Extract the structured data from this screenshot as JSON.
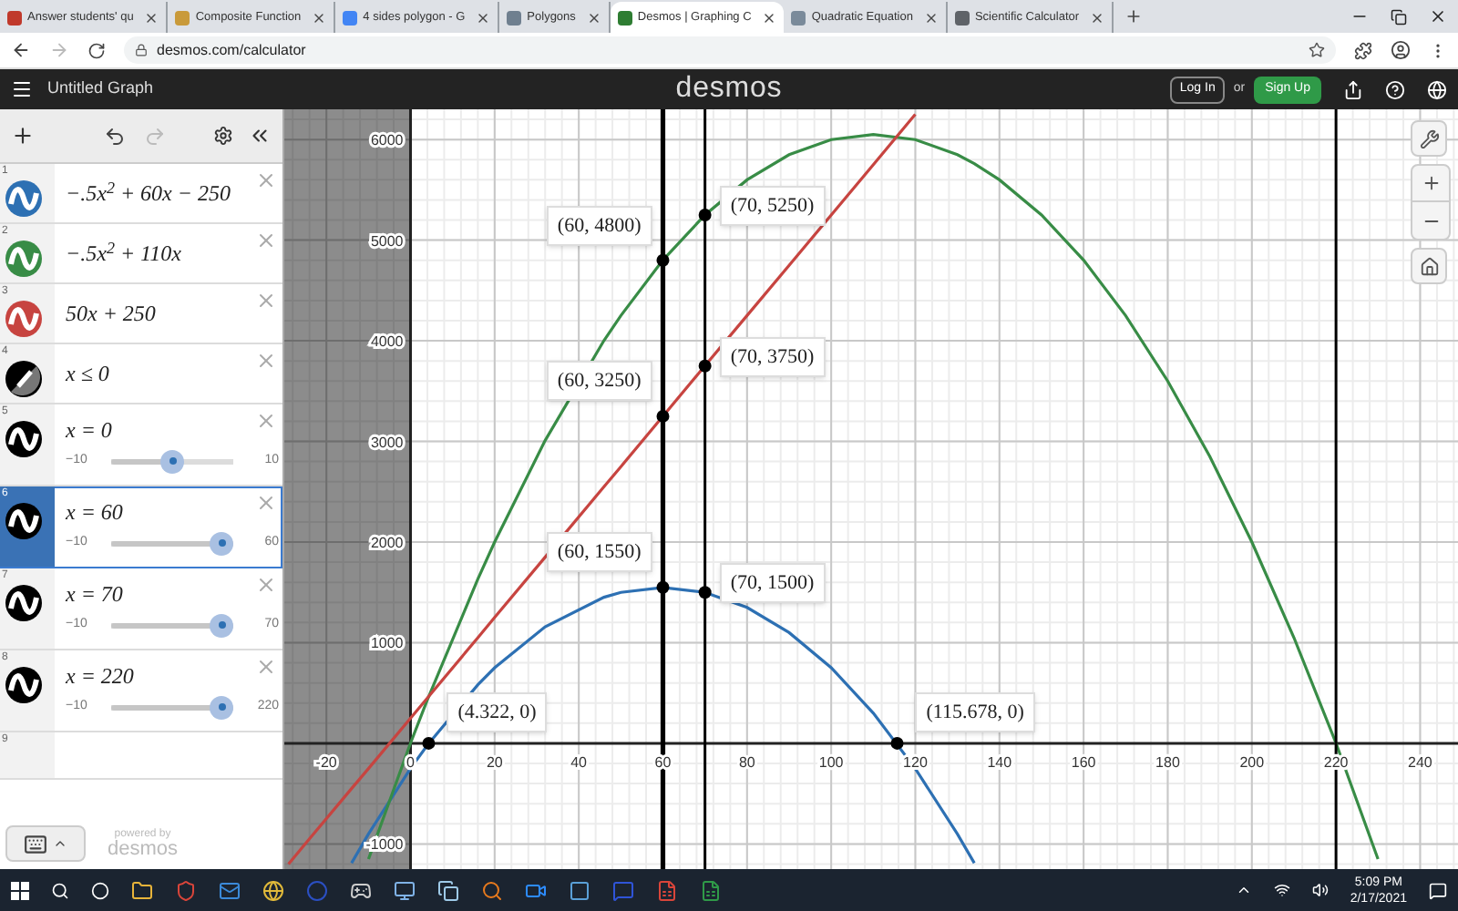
{
  "browser": {
    "tabs": [
      {
        "title": "Answer students' qu",
        "color": "#c0392b",
        "selected": false
      },
      {
        "title": "Composite Function",
        "color": "#c99a3a",
        "selected": false
      },
      {
        "title": "4 sides polygon - G",
        "color": "#4285f4",
        "selected": false
      },
      {
        "title": "Polygons",
        "color": "#6f7f8f",
        "selected": false
      },
      {
        "title": "Desmos | Graphing C",
        "color": "#2e7d32",
        "selected": true
      },
      {
        "title": "Quadratic Equation",
        "color": "#7a8a9a",
        "selected": false
      },
      {
        "title": "Scientific Calculator",
        "color": "#5f6368",
        "selected": false
      }
    ],
    "address": "desmos.com/calculator"
  },
  "header": {
    "title": "Untitled Graph",
    "logo": "desmos",
    "login": "Log In",
    "or": "or",
    "signup": "Sign Up"
  },
  "expressions": [
    {
      "index": "1",
      "kind": "function",
      "color": "#2d70b3",
      "latex": "−.5x$^{2}$ + 60x − 250",
      "selected": false
    },
    {
      "index": "2",
      "kind": "function",
      "color": "#388c46",
      "latex": "−.5x$^{2}$ + 110x",
      "selected": false
    },
    {
      "index": "3",
      "kind": "function",
      "color": "#c74440",
      "latex": "50x + 250",
      "selected": false
    },
    {
      "index": "4",
      "kind": "inequality",
      "color": "#000000",
      "latex": "x ≤ 0",
      "selected": false
    },
    {
      "index": "5",
      "kind": "slider",
      "color": "#000000",
      "latex": "x = 0",
      "min": "−10",
      "max": "10",
      "level": 0.5,
      "selected": false
    },
    {
      "index": "6",
      "kind": "slider",
      "color": "#000000",
      "latex": "x = 60",
      "min": "−10",
      "max": "60",
      "level": 1,
      "selected": true
    },
    {
      "index": "7",
      "kind": "slider",
      "color": "#000000",
      "latex": "x = 70",
      "min": "−10",
      "max": "70",
      "level": 1,
      "selected": false
    },
    {
      "index": "8",
      "kind": "slider",
      "color": "#000000",
      "latex": "x = 220",
      "min": "−10",
      "max": "220",
      "level": 1,
      "selected": false
    },
    {
      "index": "9",
      "kind": "empty",
      "selected": false
    }
  ],
  "footer": {
    "powered": "powered by",
    "brand": "desmos"
  },
  "graph": {
    "chart_data": {
      "type": "line",
      "x": [
        -29,
        -24,
        -14,
        -10,
        0,
        4,
        16,
        20,
        32,
        46,
        50,
        60,
        70,
        80,
        90,
        100,
        110,
        120,
        130,
        134,
        140,
        150,
        160,
        170,
        180,
        190,
        200,
        210,
        220,
        230
      ],
      "series": [
        {
          "color": "#2d70b3",
          "values": [
            null,
            null,
            -1190,
            -900,
            -250,
            -18,
            582,
            750,
            1158,
            1452,
            1500,
            1550,
            1500,
            1350,
            1100,
            750,
            300,
            -250,
            -900,
            -1190,
            null,
            null,
            null,
            null,
            null,
            null,
            null,
            null,
            null,
            null
          ]
        },
        {
          "color": "#388c46",
          "values": [
            null,
            null,
            null,
            -1150,
            0,
            432,
            1632,
            2000,
            3008,
            4002,
            4250,
            4800,
            5250,
            5600,
            5850,
            6000,
            6050,
            6000,
            5850,
            5760,
            5600,
            5250,
            4800,
            4250,
            3600,
            2850,
            2000,
            1050,
            0,
            -1150
          ]
        },
        {
          "color": "#c74440",
          "values": [
            -1200,
            -950,
            -450,
            -250,
            250,
            450,
            1050,
            1250,
            1850,
            2550,
            2750,
            3250,
            3750,
            4250,
            4750,
            5250,
            5750,
            6250,
            null,
            null,
            null,
            null,
            null,
            null,
            null,
            null,
            null,
            null,
            null,
            null
          ]
        }
      ],
      "grid": true,
      "xlim": [
        -30,
        249
      ],
      "ylim": [
        -1250,
        6300
      ],
      "xticks": [
        -20,
        0,
        20,
        40,
        60,
        80,
        100,
        120,
        140,
        160,
        180,
        200,
        220,
        240
      ],
      "yticks": [
        -1000,
        1000,
        2000,
        3000,
        4000,
        5000,
        6000
      ],
      "bands": [
        {
          "axis": "x",
          "from": -30,
          "to": 0
        }
      ],
      "ref_lines": [
        {
          "axis": "x",
          "value": 60
        },
        {
          "axis": "x",
          "value": 70
        },
        {
          "axis": "x",
          "value": 220
        }
      ],
      "annotations": [
        {
          "x": 60,
          "y": 4800,
          "text": "(60, 4800)"
        },
        {
          "x": 70,
          "y": 5250,
          "text": "(70, 5250)"
        },
        {
          "x": 60,
          "y": 3250,
          "text": "(60, 3250)"
        },
        {
          "x": 70,
          "y": 3750,
          "text": "(70, 3750)"
        },
        {
          "x": 60,
          "y": 1550,
          "text": "(60, 1550)"
        },
        {
          "x": 70,
          "y": 1500,
          "text": "(70, 1500)"
        },
        {
          "x": 4.322,
          "y": 0,
          "text": "(4.322, 0)"
        },
        {
          "x": 115.678,
          "y": 0,
          "text": "(115.678, 0)"
        }
      ]
    }
  },
  "taskbar": {
    "time": "5:09 PM",
    "date": "2/17/2021"
  }
}
